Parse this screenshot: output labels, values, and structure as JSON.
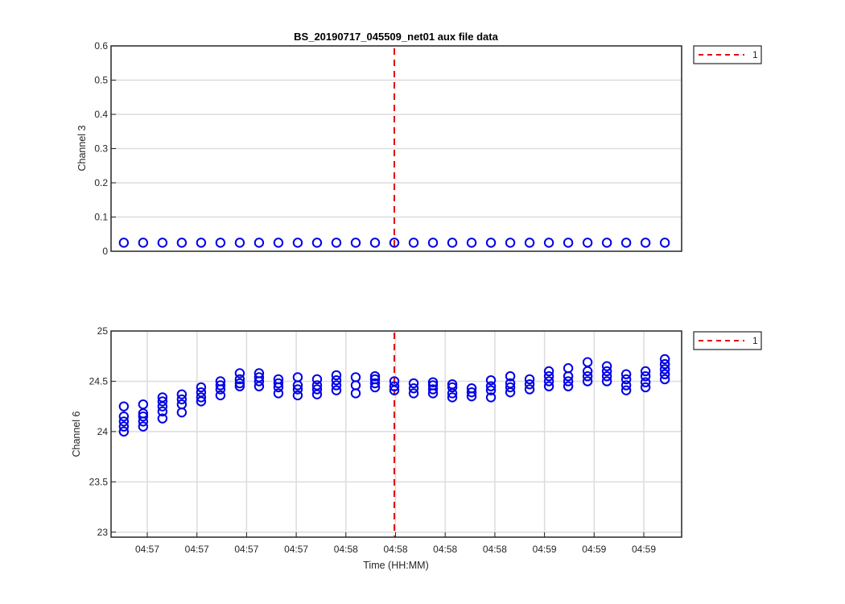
{
  "chart_data": [
    {
      "type": "scatter",
      "title": "BS_20190717_045509_net01 aux file data",
      "xlabel": "",
      "ylabel": "Channel 3",
      "ylim": [
        0,
        0.6
      ],
      "yticks": [
        "0",
        "0.1",
        "0.2",
        "0.3",
        "0.4",
        "0.5",
        "0.6"
      ],
      "xlim": [
        0,
        1
      ],
      "grid": "horizontal",
      "marker": "circle",
      "marker_color": "#0000e6",
      "x": [
        0.01,
        0.045,
        0.08,
        0.115,
        0.15,
        0.185,
        0.22,
        0.255,
        0.29,
        0.325,
        0.36,
        0.395,
        0.43,
        0.465,
        0.5,
        0.535,
        0.57,
        0.605,
        0.64,
        0.675,
        0.71,
        0.745,
        0.78,
        0.815,
        0.85,
        0.885,
        0.92,
        0.955,
        0.99
      ],
      "series": [
        {
          "values": [
            0.025,
            0.025,
            0.025,
            0.025,
            0.025,
            0.025,
            0.025,
            0.025,
            0.025,
            0.025,
            0.025,
            0.025,
            0.025,
            0.025,
            0.025,
            0.025,
            0.025,
            0.025,
            0.025,
            0.025,
            0.025,
            0.025,
            0.025,
            0.025,
            0.025,
            0.025,
            0.025,
            0.025,
            0.025
          ]
        }
      ],
      "vline": {
        "x": 0.5,
        "color": "#e60000",
        "style": "dashed"
      },
      "legend": {
        "entries": [
          "1"
        ],
        "placement": "outside-top-right"
      }
    },
    {
      "type": "scatter",
      "title": "",
      "xlabel": "Time (HH:MM)",
      "ylabel": "Channel 6",
      "ylim": [
        22.95,
        25
      ],
      "yticks": [
        "23",
        "23.5",
        "24",
        "24.5",
        "25"
      ],
      "xlim": [
        0,
        1
      ],
      "xticks": [
        "04:57",
        "04:57",
        "04:57",
        "04:57",
        "04:58",
        "04:58",
        "04:58",
        "04:58",
        "04:59",
        "04:59",
        "04:59"
      ],
      "grid": "both",
      "marker": "circle",
      "marker_color": "#0000e6",
      "x": [
        0.01,
        0.045,
        0.08,
        0.115,
        0.15,
        0.185,
        0.22,
        0.255,
        0.29,
        0.325,
        0.36,
        0.395,
        0.43,
        0.465,
        0.5,
        0.535,
        0.57,
        0.605,
        0.64,
        0.675,
        0.71,
        0.745,
        0.78,
        0.815,
        0.85,
        0.885,
        0.92,
        0.955,
        0.99
      ],
      "clusters": [
        [
          24.0,
          24.05,
          24.1,
          24.15,
          24.25
        ],
        [
          24.05,
          24.1,
          24.15,
          24.18,
          24.27
        ],
        [
          24.13,
          24.2,
          24.25,
          24.3,
          24.34
        ],
        [
          24.19,
          24.27,
          24.32,
          24.37
        ],
        [
          24.3,
          24.34,
          24.39,
          24.44
        ],
        [
          24.36,
          24.42,
          24.46,
          24.5
        ],
        [
          24.45,
          24.48,
          24.52,
          24.58
        ],
        [
          24.45,
          24.5,
          24.54,
          24.58
        ],
        [
          24.38,
          24.44,
          24.48,
          24.52
        ],
        [
          24.36,
          24.42,
          24.46,
          24.54
        ],
        [
          24.37,
          24.42,
          24.46,
          24.52
        ],
        [
          24.41,
          24.46,
          24.51,
          24.56
        ],
        [
          24.38,
          24.46,
          24.54
        ],
        [
          24.44,
          24.48,
          24.52,
          24.55
        ],
        [
          24.41,
          24.45,
          24.5
        ],
        [
          24.38,
          24.43,
          24.48
        ],
        [
          24.38,
          24.42,
          24.46,
          24.49
        ],
        [
          24.34,
          24.38,
          24.44,
          24.47
        ],
        [
          24.35,
          24.39,
          24.43
        ],
        [
          24.34,
          24.41,
          24.45,
          24.51
        ],
        [
          24.39,
          24.44,
          24.48,
          24.55
        ],
        [
          24.42,
          24.47,
          24.52
        ],
        [
          24.45,
          24.5,
          24.55,
          24.6
        ],
        [
          24.45,
          24.5,
          24.55,
          24.63
        ],
        [
          24.5,
          24.55,
          24.6,
          24.69
        ],
        [
          24.5,
          24.55,
          24.6,
          24.65
        ],
        [
          24.41,
          24.46,
          24.52,
          24.57
        ],
        [
          24.44,
          24.49,
          24.55,
          24.6
        ],
        [
          24.52,
          24.57,
          24.62,
          24.67
        ],
        [
          24.57,
          24.62,
          24.67,
          24.72
        ]
      ],
      "vline": {
        "x": 0.5,
        "color": "#e60000",
        "style": "dashed"
      },
      "legend": {
        "entries": [
          "1"
        ],
        "placement": "outside-top-right"
      }
    }
  ]
}
